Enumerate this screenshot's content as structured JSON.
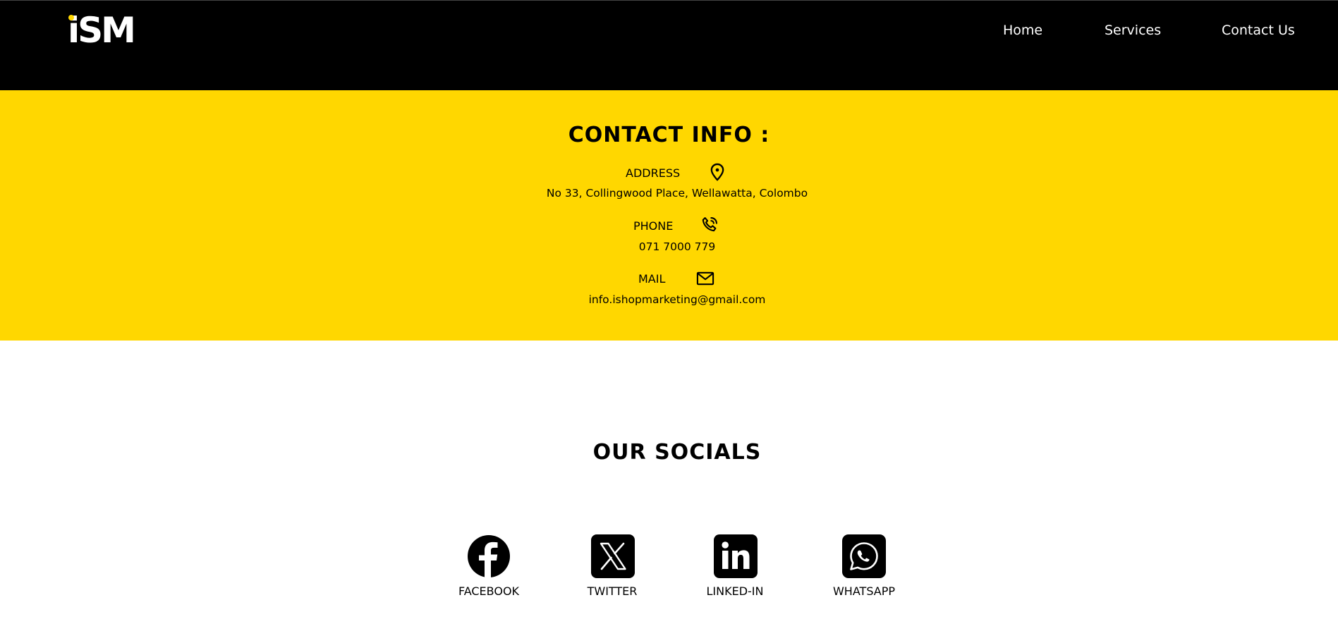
{
  "header": {
    "logo_text": "iSM",
    "nav": [
      "Home",
      "Services",
      "Contact Us"
    ]
  },
  "contact": {
    "title": "CONTACT INFO :",
    "address_label": "ADDRESS",
    "address_value": "No 33, Collingwood Place, Wellawatta, Colombo",
    "phone_label": "PHONE",
    "phone_value": "071 7000 779",
    "mail_label": "MAIL",
    "mail_value": "info.ishopmarketing@gmail.com"
  },
  "socials": {
    "title": "OUR SOCIALS",
    "items": [
      {
        "label": "FACEBOOK",
        "icon": "facebook-icon"
      },
      {
        "label": "TWITTER",
        "icon": "x-twitter-icon"
      },
      {
        "label": "LINKED-IN",
        "icon": "linkedin-icon"
      },
      {
        "label": "WHATSAPP",
        "icon": "whatsapp-icon"
      }
    ]
  },
  "colors": {
    "header_bg": "#000000",
    "accent_yellow": "#FFD700",
    "page_bg": "#FFFFFF"
  }
}
